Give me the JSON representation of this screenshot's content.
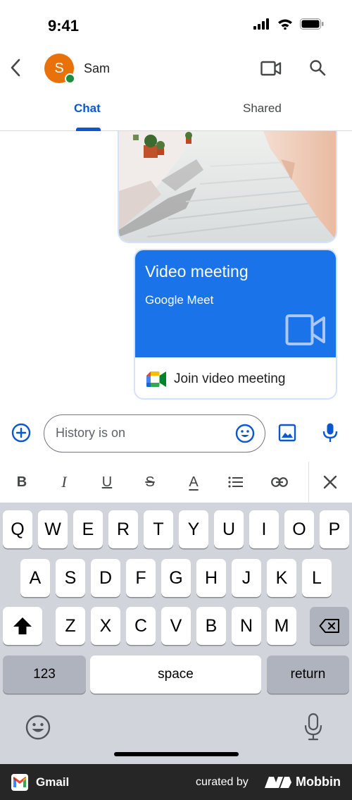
{
  "status_bar": {
    "time": "9:41"
  },
  "header": {
    "avatar_initial": "S",
    "contact_name": "Sam"
  },
  "tabs": [
    {
      "label": "Chat",
      "selected": true
    },
    {
      "label": "Shared",
      "selected": false
    }
  ],
  "meet_card": {
    "title": "Video meeting",
    "subtitle": "Google Meet",
    "join_label": "Join video meeting"
  },
  "composer": {
    "placeholder": "History is on"
  },
  "formatting": {
    "bold": "B",
    "italic": "I",
    "underline": "U",
    "strikethrough": "S",
    "text_color": "A"
  },
  "keyboard": {
    "row1": [
      "Q",
      "W",
      "E",
      "R",
      "T",
      "Y",
      "U",
      "I",
      "O",
      "P"
    ],
    "row2": [
      "A",
      "S",
      "D",
      "F",
      "G",
      "H",
      "J",
      "K",
      "L"
    ],
    "row3": [
      "Z",
      "X",
      "C",
      "V",
      "B",
      "N",
      "M"
    ],
    "numbers": "123",
    "space": "space",
    "return": "return"
  },
  "footer": {
    "app_name": "Gmail",
    "curated_by": "curated by",
    "brand": "Mobbin"
  },
  "colors": {
    "accent": "#0b57d0",
    "meet_blue": "#1a73e8",
    "avatar": "#e8710a",
    "presence": "#1e8e3e"
  }
}
